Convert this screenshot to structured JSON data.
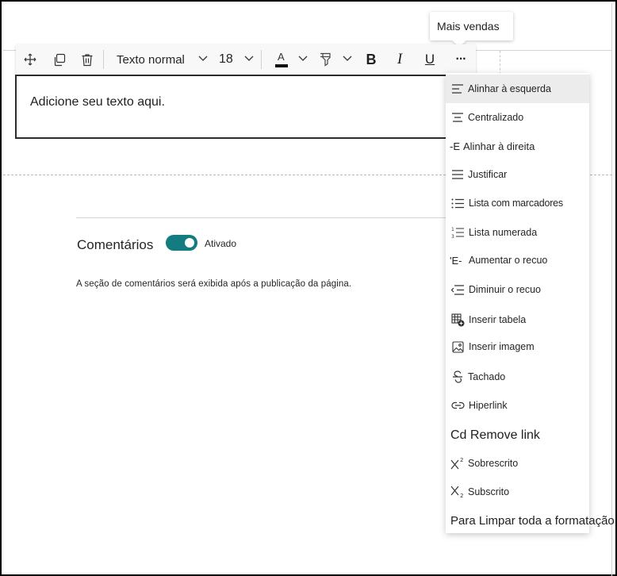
{
  "tooltip": {
    "text": "Mais vendas"
  },
  "toolbar": {
    "move_icon": "move-icon",
    "copy_icon": "copy-icon",
    "delete_icon": "trash-icon",
    "style_value": "Texto normal",
    "size_value": "18",
    "bold_label": "B",
    "italic_label": "I",
    "underline_label": "U",
    "more_label": "···",
    "font_color_label": "A",
    "font_color": "#111111"
  },
  "editor": {
    "placeholder_text": "Adicione seu texto aqui."
  },
  "comments": {
    "label": "Comentários",
    "toggle_state": "Ativado",
    "toggle_color": "#137c80",
    "note": "A seção de comentários será exibida após a publicação da página."
  },
  "menu": {
    "items": [
      {
        "icon": "align-left-icon",
        "icon_text": "",
        "label": "Alinhar à esquerda"
      },
      {
        "icon": "align-center-icon",
        "icon_text": "",
        "label": "Centralizado"
      },
      {
        "icon": "",
        "icon_text": "-E",
        "label": "Alinhar à direita"
      },
      {
        "icon": "justify-icon",
        "icon_text": "",
        "label": "Justificar"
      },
      {
        "icon": "bulleted-list-icon",
        "icon_text": "",
        "label": "Lista com marcadores"
      },
      {
        "icon": "numbered-list-icon",
        "icon_text": "",
        "label": "Lista numerada"
      },
      {
        "icon": "",
        "icon_text": "'E-",
        "label": "Aumentar o recuo"
      },
      {
        "icon": "decrease-indent-icon",
        "icon_text": "",
        "label": "Diminuir o recuo"
      },
      {
        "icon": "insert-table-icon",
        "icon_text": "",
        "label": "Inserir tabela"
      },
      {
        "icon": "insert-image-icon",
        "icon_text": "",
        "label": "Inserir imagem"
      },
      {
        "icon": "strikethrough-icon",
        "icon_text": "",
        "label": "Tachado"
      },
      {
        "icon": "link-icon",
        "icon_text": "",
        "label": "Hiperlink"
      },
      {
        "icon": "",
        "icon_text": "",
        "label": "Cd Remove link"
      },
      {
        "icon": "superscript-icon",
        "icon_text": "",
        "label": "Sobrescrito"
      },
      {
        "icon": "subscript-icon",
        "icon_text": "",
        "label": "Subscrito"
      },
      {
        "icon": "",
        "icon_text": "",
        "label": "Para Limpar toda a formatação"
      }
    ]
  }
}
